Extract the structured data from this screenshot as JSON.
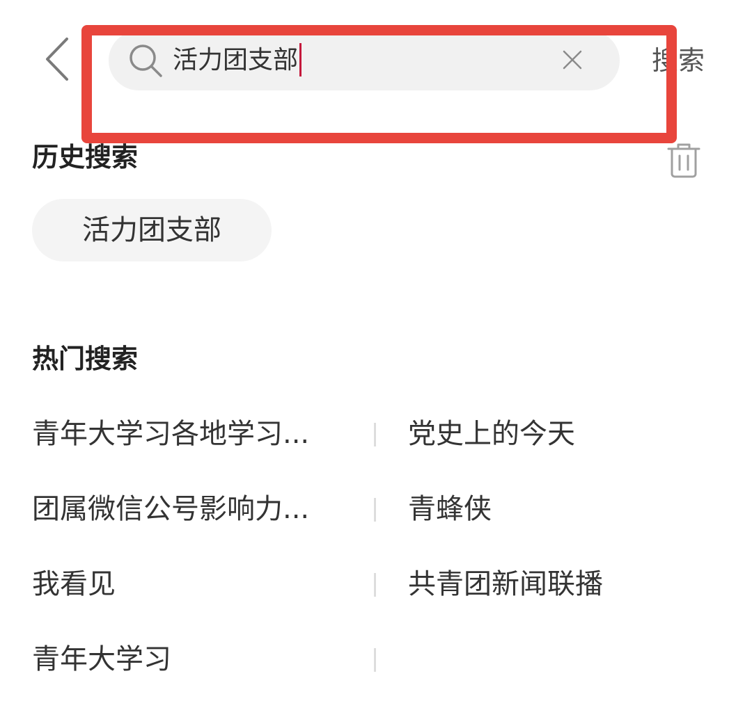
{
  "header": {
    "search": {
      "value": "活力团支部"
    },
    "search_label": "搜索"
  },
  "history": {
    "title": "历史搜索",
    "items": [
      "活力团支部"
    ]
  },
  "hot": {
    "title": "热门搜索",
    "items": [
      "青年大学习各地学习...",
      "党史上的今天",
      "团属微信公号影响力...",
      "青蜂侠",
      "我看见",
      "共青团新闻联播",
      "青年大学习"
    ]
  },
  "colors": {
    "highlight": "#e8453c",
    "caret": "#c4183c"
  },
  "icons": {
    "back": "chevron-left-icon",
    "search": "search-icon",
    "clear": "close-icon",
    "trash": "trash-icon"
  }
}
